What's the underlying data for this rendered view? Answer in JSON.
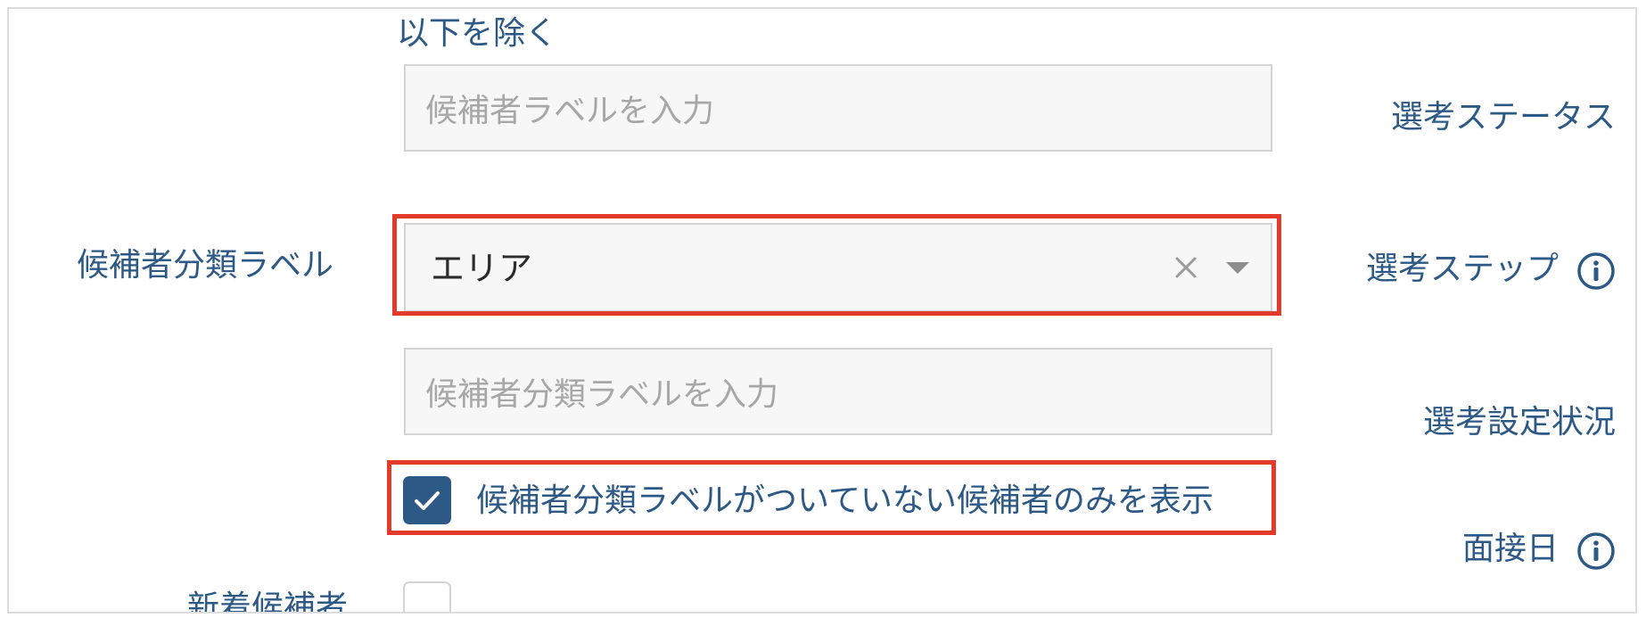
{
  "exclude_section": {
    "heading": "以下を除く",
    "candidate_label_input": {
      "placeholder": "候補者ラベルを入力",
      "value": ""
    }
  },
  "candidate_class_label": {
    "label": "候補者分類ラベル",
    "select": {
      "selected_value": "エリア",
      "clear_icon": "close-icon",
      "dropdown_icon": "chevron-down-icon"
    },
    "input": {
      "placeholder": "候補者分類ラベルを入力",
      "value": ""
    },
    "only_unlabeled_checkbox": {
      "label": "候補者分類ラベルがついていない候補者のみを表示",
      "checked": true
    }
  },
  "new_candidates": {
    "label": "新着候補者",
    "checked": false
  },
  "right_column": {
    "selection_status": "選考ステータス",
    "selection_step": "選考ステップ",
    "selection_settings_status": "選考設定状況",
    "interview_date": "面接日",
    "info_icon": "info-icon"
  },
  "colors": {
    "label_blue": "#2d5986",
    "highlight_red": "#e33a2c",
    "field_bg": "#f7f7f7",
    "placeholder": "#a7a7a7"
  }
}
